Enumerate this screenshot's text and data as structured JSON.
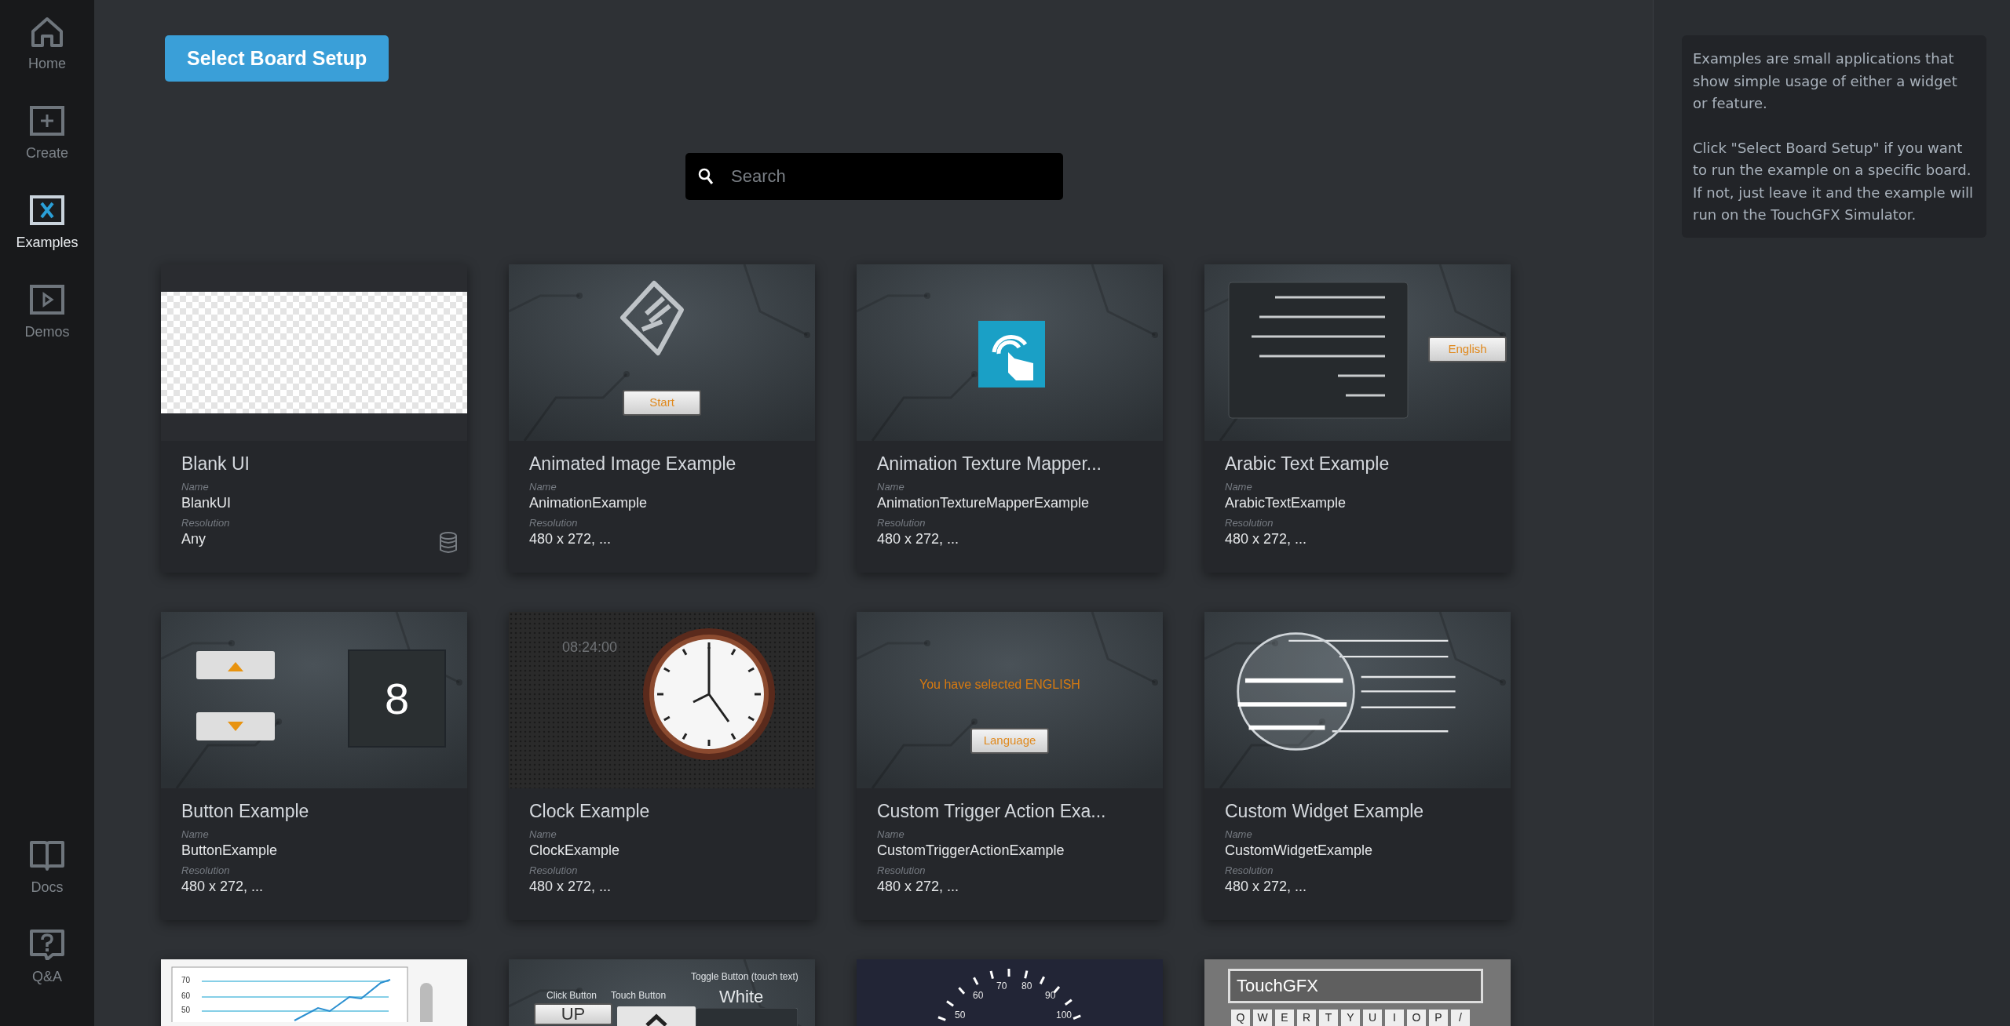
{
  "sidebar": {
    "top_items": [
      {
        "label": "Home",
        "kind": "home",
        "selected": false
      },
      {
        "label": "Create",
        "kind": "create",
        "selected": false
      },
      {
        "label": "Examples",
        "kind": "examples",
        "selected": true
      },
      {
        "label": "Demos",
        "kind": "demos",
        "selected": false
      }
    ],
    "bottom_items": [
      {
        "label": "Docs",
        "kind": "docs",
        "selected": false
      },
      {
        "label": "Q&A",
        "kind": "qa",
        "selected": false
      }
    ]
  },
  "select_board_button": "Select Board Setup",
  "search": {
    "placeholder": "Search"
  },
  "cards": [
    {
      "title": "Blank UI",
      "name_label": "Name",
      "name": "BlankUI",
      "resolution_label": "Resolution",
      "resolution": "Any",
      "database_icon": true,
      "thumbnail": {
        "kind": "checker"
      }
    },
    {
      "title": "Animated Image Example",
      "name_label": "Name",
      "name": "AnimationExample",
      "resolution_label": "Resolution",
      "resolution": "480 x 272, ...",
      "database_icon": false,
      "thumbnail": {
        "kind": "hand-start",
        "texts": [
          "Start"
        ]
      }
    },
    {
      "title": "Animation Texture Mapper...",
      "name_label": "Name",
      "name": "AnimationTextureMapperExample",
      "resolution_label": "Resolution",
      "resolution": "480 x 272, ...",
      "database_icon": false,
      "thumbnail": {
        "kind": "touch-icon"
      }
    },
    {
      "title": "Arabic Text Example",
      "name_label": "Name",
      "name": "ArabicTextExample",
      "resolution_label": "Resolution",
      "resolution": "480 x 272, ...",
      "database_icon": false,
      "thumbnail": {
        "kind": "arabic",
        "texts": [
          "English"
        ]
      }
    },
    {
      "title": "Button Example",
      "name_label": "Name",
      "name": "ButtonExample",
      "resolution_label": "Resolution",
      "resolution": "480 x 272, ...",
      "database_icon": false,
      "thumbnail": {
        "kind": "buttons",
        "texts": [
          "8"
        ]
      }
    },
    {
      "title": "Clock Example",
      "name_label": "Name",
      "name": "ClockExample",
      "resolution_label": "Resolution",
      "resolution": "480 x 272, ...",
      "database_icon": false,
      "thumbnail": {
        "kind": "clock",
        "texts": [
          "08:24:00"
        ]
      }
    },
    {
      "title": "Custom Trigger Action Exa...",
      "name_label": "Name",
      "name": "CustomTriggerActionExample",
      "resolution_label": "Resolution",
      "resolution": "480 x 272, ...",
      "database_icon": false,
      "thumbnail": {
        "kind": "trigger",
        "texts": [
          "You have selected ENGLISH",
          "Language"
        ]
      }
    },
    {
      "title": "Custom Widget Example",
      "name_label": "Name",
      "name": "CustomWidgetExample",
      "resolution_label": "Resolution",
      "resolution": "480 x 272, ...",
      "database_icon": false,
      "thumbnail": {
        "kind": "lens"
      }
    },
    {
      "thumbnail": {
        "kind": "graph",
        "texts": [
          "70",
          "60",
          "50"
        ]
      }
    },
    {
      "thumbnail": {
        "kind": "toggle",
        "texts": [
          "Click Button",
          "Touch Button",
          "Toggle Button (touch text)",
          "White",
          "UP"
        ]
      }
    },
    {
      "thumbnail": {
        "kind": "gauge",
        "texts": [
          "60",
          "70",
          "80",
          "90",
          "50",
          "100"
        ]
      }
    },
    {
      "thumbnail": {
        "kind": "keyboard",
        "texts": [
          "TouchGFX",
          "Q",
          "W",
          "E",
          "R",
          "T",
          "Y",
          "U",
          "I",
          "O",
          "P",
          "/"
        ]
      }
    }
  ],
  "info_panel": {
    "paragraphs": [
      "Examples are small applications that show simple usage of either a widget or feature.",
      "Click \"Select Board Setup\" if you want to run the example on a specific board. If not, just leave it and the example will run on the TouchGFX Simulator."
    ]
  }
}
